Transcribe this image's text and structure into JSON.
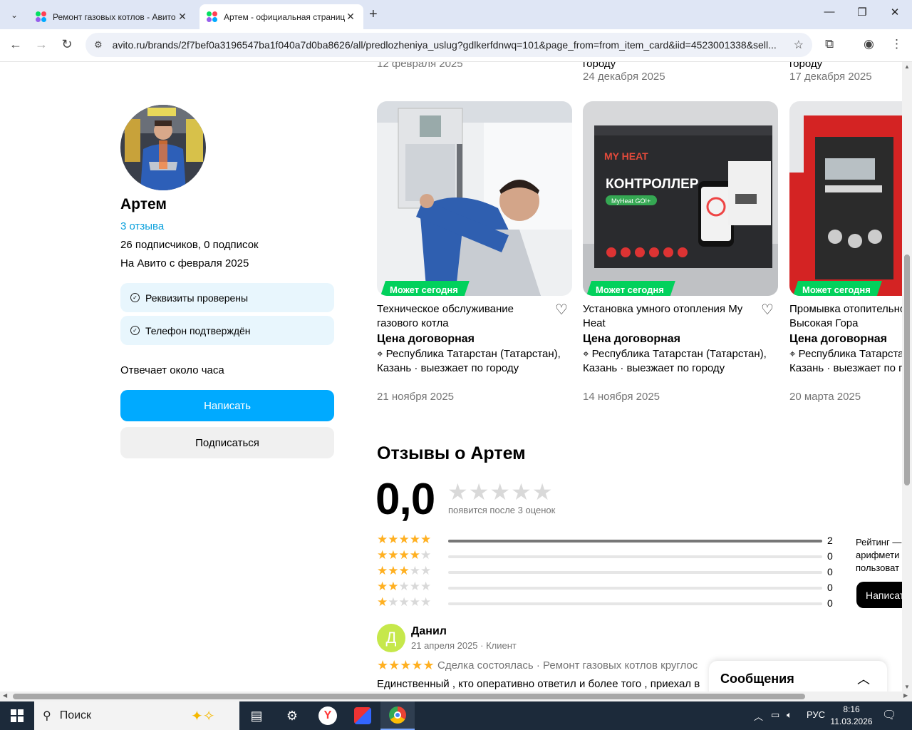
{
  "browser": {
    "tabs": [
      {
        "label": "Ремонт газовых котлов - Авито",
        "active": false
      },
      {
        "label": "Артем - официальная страница",
        "active": true
      }
    ],
    "url": "avito.ru/brands/2f7bef0a3196547ba1f040a7d0ba8626/all/predlozheniya_uslug?gdlkerfdnwq=101&page_from=from_item_card&iid=4523001338&sell..."
  },
  "top_strip": {
    "col1_date": "12 февраля 2025",
    "col2_text": "городу",
    "col2_date": "24 декабря 2025",
    "col3_text": "городу",
    "col3_date": "17 декабря 2025"
  },
  "seller": {
    "name": "Артем",
    "reviews_link": "3 отзыва",
    "followers": "26 подписчиков, 0 подписок",
    "since": "На Авито с февраля 2025",
    "badges": [
      "Реквизиты проверены",
      "Телефон подтверждён"
    ],
    "response_time": "Отвечает около часа",
    "write_button": "Написать",
    "subscribe_button": "Подписаться"
  },
  "listings": [
    {
      "pill": "Может сегодня",
      "title": "Техническое обслуживание газового котла",
      "price": "Цена договорная",
      "location": "Республика Татарстан (Татарстан), Казань · выезжает по городу",
      "date": "21 ноября 2025"
    },
    {
      "pill": "Может сегодня",
      "title": "Установка умного отопления My Heat",
      "price": "Цена договорная",
      "location": "Республика Татарстан (Татарстан), Казань · выезжает по городу",
      "date": "14 ноября 2025"
    },
    {
      "pill": "Может сегодня",
      "title": "Промывка отопительной системы Высокая Гора",
      "price": "Цена договорная",
      "location": "Республика Татарстан (Татарстан), Казань · выезжает по городу",
      "date": "20 марта 2025"
    }
  ],
  "image_text": {
    "controller": "КОНТРОЛЛЕР",
    "myheat_brand": "MY HEAT",
    "myheat_model": "MyHeat GO!+"
  },
  "reviews": {
    "title": "Отзывы о Артем",
    "rating": "0,0",
    "rating_note": "появится после 3 оценок",
    "distribution": [
      {
        "stars": 5,
        "count": "2",
        "fraction": 1.0
      },
      {
        "stars": 4,
        "count": "0",
        "fraction": 0
      },
      {
        "stars": 3,
        "count": "0",
        "fraction": 0
      },
      {
        "stars": 2,
        "count": "0",
        "fraction": 0
      },
      {
        "stars": 1,
        "count": "0",
        "fraction": 0
      }
    ],
    "side_note": [
      "Рейтинг —",
      "арифмети",
      "пользоват"
    ],
    "side_button": "Написат",
    "items": [
      {
        "avatar_letter": "Д",
        "author": "Данил",
        "meta": "21 апреля 2025 · Клиент",
        "deal": "Сделка состоялась · Ремонт газовых котлов круглос",
        "text": "Единственный , кто оперативно ответил и более того , приехал в"
      }
    ]
  },
  "messages_panel": {
    "title": "Сообщения"
  },
  "taskbar": {
    "search_placeholder": "Поиск",
    "language": "РУС",
    "time": "8:16",
    "date": "11.03.2026"
  },
  "colors": {
    "accent": "#00aaff",
    "link": "#0aa0dc",
    "pill_green": "#02d15c",
    "star_gold": "#ffb021",
    "badge_bg": "#e8f6fd"
  }
}
